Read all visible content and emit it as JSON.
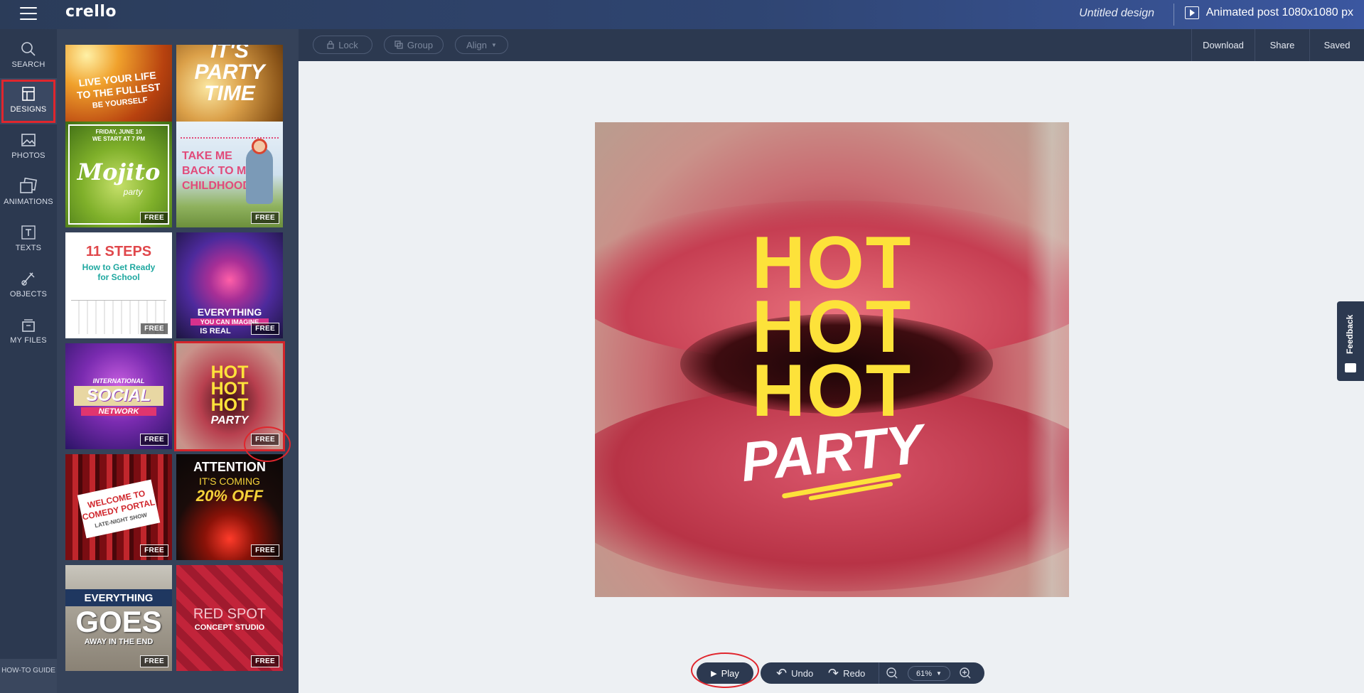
{
  "app": {
    "logo": "crello",
    "doc_title": "Untitled design",
    "format": "Animated post 1080x1080 px"
  },
  "rail": {
    "items": [
      {
        "label": "SEARCH",
        "icon": "search-icon"
      },
      {
        "label": "DESIGNS",
        "icon": "designs-icon",
        "active": true
      },
      {
        "label": "PHOTOS",
        "icon": "photos-icon"
      },
      {
        "label": "ANIMATIONS",
        "icon": "animations-icon"
      },
      {
        "label": "TEXTS",
        "icon": "texts-icon"
      },
      {
        "label": "OBJECTS",
        "icon": "objects-icon"
      },
      {
        "label": "MY FILES",
        "icon": "my-files-icon"
      }
    ],
    "howto": "HOW-TO GUIDE"
  },
  "templates": {
    "badge": "FREE",
    "items": [
      {
        "name": "live-your-life",
        "lines": [
          "LIVE YOUR LIFE",
          "TO THE FULLEST",
          "BE YOURSELF"
        ]
      },
      {
        "name": "its-party-time",
        "lines": [
          "IT'S",
          "PARTY",
          "TIME"
        ]
      },
      {
        "name": "mojito-party",
        "lines": [
          "FRIDAY, JUNE 10",
          "WE START AT 7 PM",
          "Mojito",
          "party"
        ]
      },
      {
        "name": "take-me-back",
        "lines": [
          "TAKE ME",
          "BACK TO MY",
          "CHILDHOOD"
        ]
      },
      {
        "name": "11-steps",
        "lines": [
          "11 STEPS",
          "How to Get Ready",
          "for School"
        ]
      },
      {
        "name": "everything-imagine",
        "lines": [
          "EVERYTHING",
          "YOU CAN IMAGINE",
          "IS REAL"
        ]
      },
      {
        "name": "social-network",
        "lines": [
          "INTERNATIONAL",
          "SOCIAL",
          "NETWORK"
        ]
      },
      {
        "name": "hot-party",
        "lines": [
          "HOT",
          "HOT",
          "HOT",
          "PARTY"
        ],
        "selected": true
      },
      {
        "name": "comedy-portal",
        "lines": [
          "WELCOME TO",
          "COMEDY PORTAL",
          "LATE-NIGHT SHOW"
        ]
      },
      {
        "name": "attention-20-off",
        "lines": [
          "ATTENTION",
          "IT'S COMING",
          "20% OFF"
        ]
      },
      {
        "name": "everything-goes",
        "lines": [
          "EVERYTHING",
          "GOES",
          "AWAY IN THE END"
        ]
      },
      {
        "name": "red-spot",
        "lines": [
          "RED SPOT",
          "CONCEPT STUDIO"
        ]
      }
    ]
  },
  "toolbar": {
    "lock": "Lock",
    "group": "Group",
    "align": "Align",
    "download": "Download",
    "share": "Share",
    "saved": "Saved"
  },
  "canvas": {
    "line1": "HOT",
    "line2": "HOT",
    "line3": "HOT",
    "line4": "PARTY"
  },
  "feedback": "Feedback",
  "controls": {
    "play": "Play",
    "undo": "Undo",
    "redo": "Redo",
    "zoom": "61%"
  },
  "colors": {
    "accent_yellow": "#fde23a",
    "annotation_red": "#e0262d",
    "sidebar": "#2c3950"
  }
}
